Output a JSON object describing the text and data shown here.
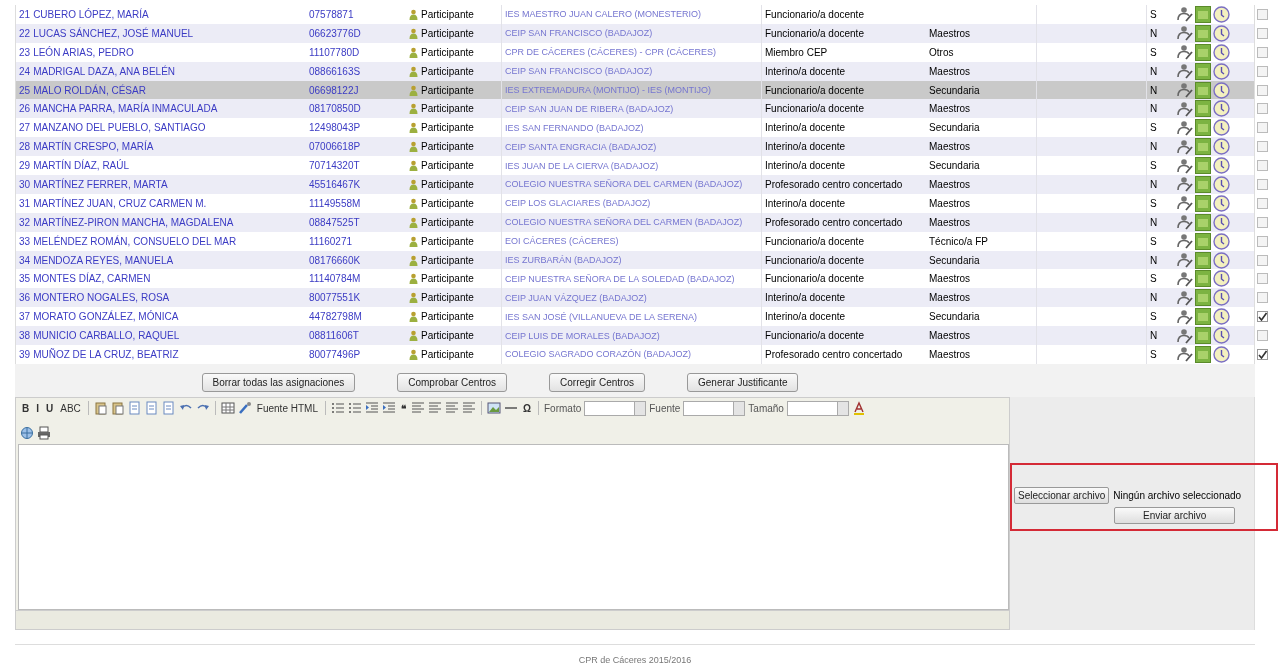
{
  "rows": [
    {
      "number": "21",
      "name": "CUBERO LÓPEZ, MARÍA",
      "code": "07578871",
      "role": "Participante",
      "center": "IES MAESTRO JUAN CALERO (MONESTERIO)",
      "type": "Funcionario/a docente",
      "level": "",
      "flag": "S",
      "selected": false,
      "checked": false
    },
    {
      "number": "22",
      "name": "LUCAS SÁNCHEZ, JOSÉ MANUEL",
      "code": "06623776D",
      "role": "Participante",
      "center": "CEIP SAN FRANCISCO (BADAJOZ)",
      "type": "Funcionario/a docente",
      "level": "Maestros",
      "flag": "N",
      "selected": false,
      "checked": false
    },
    {
      "number": "23",
      "name": "LEÓN ARIAS, PEDRO",
      "code": "11107780D",
      "role": "Participante",
      "center": "CPR DE CÁCERES (CÁCERES) - CPR (CÁCERES)",
      "type": "Miembro CEP",
      "level": "Otros",
      "flag": "S",
      "selected": false,
      "checked": false
    },
    {
      "number": "24",
      "name": "MADRIGAL DAZA, ANA BELÉN",
      "code": "08866163S",
      "role": "Participante",
      "center": "CEIP SAN FRANCISCO (BADAJOZ)",
      "type": "Interino/a docente",
      "level": "Maestros",
      "flag": "N",
      "selected": false,
      "checked": false
    },
    {
      "number": "25",
      "name": "MALO ROLDÁN, CÉSAR",
      "code": "06698122J",
      "role": "Participante",
      "center": "IES EXTREMADURA (MONTIJO) - IES (MONTIJO)",
      "type": "Funcionario/a docente",
      "level": "Secundaria",
      "flag": "N",
      "selected": true,
      "checked": false
    },
    {
      "number": "26",
      "name": "MANCHA PARRA, MARÍA INMACULADA",
      "code": "08170850D",
      "role": "Participante",
      "center": "CEIP SAN JUAN DE RIBERA (BADAJOZ)",
      "type": "Funcionario/a docente",
      "level": "Maestros",
      "flag": "N",
      "selected": false,
      "checked": false
    },
    {
      "number": "27",
      "name": "MANZANO DEL PUEBLO, SANTIAGO",
      "code": "12498043P",
      "role": "Participante",
      "center": "IES SAN FERNANDO (BADAJOZ)",
      "type": "Interino/a docente",
      "level": "Secundaria",
      "flag": "S",
      "selected": false,
      "checked": false
    },
    {
      "number": "28",
      "name": "MARTÍN CRESPO, MARÍA",
      "code": "07006618P",
      "role": "Participante",
      "center": "CEIP SANTA ENGRACIA (BADAJOZ)",
      "type": "Interino/a docente",
      "level": "Maestros",
      "flag": "N",
      "selected": false,
      "checked": false
    },
    {
      "number": "29",
      "name": "MARTÍN DÍAZ, RAÚL",
      "code": "70714320T",
      "role": "Participante",
      "center": "IES JUAN DE LA CIERVA (BADAJOZ)",
      "type": "Interino/a docente",
      "level": "Secundaria",
      "flag": "S",
      "selected": false,
      "checked": false
    },
    {
      "number": "30",
      "name": "MARTÍNEZ FERRER, MARTA",
      "code": "45516467K",
      "role": "Participante",
      "center": "COLEGIO NUESTRA SEÑORA DEL CARMEN (BADAJOZ)",
      "type": "Profesorado centro concertado",
      "level": "Maestros",
      "flag": "N",
      "selected": false,
      "checked": false
    },
    {
      "number": "31",
      "name": "MARTÍNEZ JUAN, CRUZ CARMEN M.",
      "code": "11149558M",
      "role": "Participante",
      "center": "CEIP LOS GLACIARES (BADAJOZ)",
      "type": "Interino/a docente",
      "level": "Maestros",
      "flag": "S",
      "selected": false,
      "checked": false
    },
    {
      "number": "32",
      "name": "MARTÍNEZ-PIRON MANCHA, MAGDALENA",
      "code": "08847525T",
      "role": "Participante",
      "center": "COLEGIO NUESTRA SEÑORA DEL CARMEN (BADAJOZ)",
      "type": "Profesorado centro concertado",
      "level": "Maestros",
      "flag": "N",
      "selected": false,
      "checked": false
    },
    {
      "number": "33",
      "name": "MELÉNDEZ ROMÁN, CONSUELO DEL MAR",
      "code": "11160271",
      "role": "Participante",
      "center": "EOI CÁCERES (CÁCERES)",
      "type": "Funcionario/a docente",
      "level": "Técnico/a FP",
      "flag": "S",
      "selected": false,
      "checked": false
    },
    {
      "number": "34",
      "name": "MENDOZA REYES, MANUELA",
      "code": "08176660K",
      "role": "Participante",
      "center": "IES ZURBARÁN (BADAJOZ)",
      "type": "Funcionario/a docente",
      "level": "Secundaria",
      "flag": "N",
      "selected": false,
      "checked": false
    },
    {
      "number": "35",
      "name": "MONTES DÍAZ, CARMEN",
      "code": "11140784M",
      "role": "Participante",
      "center": "CEIP NUESTRA SEÑORA DE LA SOLEDAD (BADAJOZ)",
      "type": "Funcionario/a docente",
      "level": "Maestros",
      "flag": "S",
      "selected": false,
      "checked": false
    },
    {
      "number": "36",
      "name": "MONTERO NOGALES, ROSA",
      "code": "80077551K",
      "role": "Participante",
      "center": "CEIP JUAN VÁZQUEZ (BADAJOZ)",
      "type": "Interino/a docente",
      "level": "Maestros",
      "flag": "N",
      "selected": false,
      "checked": false
    },
    {
      "number": "37",
      "name": "MORATO GONZÁLEZ, MÓNICA",
      "code": "44782798M",
      "role": "Participante",
      "center": "IES SAN JOSÉ (VILLANUEVA DE LA SERENA)",
      "type": "Interino/a docente",
      "level": "Secundaria",
      "flag": "S",
      "selected": false,
      "checked": true
    },
    {
      "number": "38",
      "name": "MUNICIO CARBALLO, RAQUEL",
      "code": "08811606T",
      "role": "Participante",
      "center": "CEIP LUIS DE MORALES (BADAJOZ)",
      "type": "Funcionario/a docente",
      "level": "Maestros",
      "flag": "N",
      "selected": false,
      "checked": false
    },
    {
      "number": "39",
      "name": "MUÑOZ DE LA CRUZ, BEATRIZ",
      "code": "80077496P",
      "role": "Participante",
      "center": "COLEGIO SAGRADO CORAZÓN (BADAJOZ)",
      "type": "Profesorado centro concertado",
      "level": "Maestros",
      "flag": "S",
      "selected": false,
      "checked": true
    }
  ],
  "actions": [
    "Borrar todas las asignaciones",
    "Comprobar Centros",
    "Corregir Centros",
    "Generar Justificante"
  ],
  "editor": {
    "toolbar": [
      {
        "kind": "glyph",
        "text": "B"
      },
      {
        "kind": "glyph",
        "text": "I"
      },
      {
        "kind": "glyph",
        "text": "U"
      },
      {
        "kind": "glyph",
        "text": "ABC"
      },
      {
        "kind": "sep"
      },
      {
        "kind": "icon"
      },
      {
        "kind": "icon"
      },
      {
        "kind": "icon"
      },
      {
        "kind": "icon"
      },
      {
        "kind": "icon"
      },
      {
        "kind": "icon"
      },
      {
        "kind": "icon"
      },
      {
        "kind": "sep"
      },
      {
        "kind": "icon"
      },
      {
        "kind": "icon"
      },
      {
        "kind": "glyph",
        "text": "Fuente HTML"
      },
      {
        "kind": "sep"
      },
      {
        "kind": "icon"
      },
      {
        "kind": "icon"
      },
      {
        "kind": "icon"
      },
      {
        "kind": "icon"
      },
      {
        "kind": "glyph",
        "text": "❝"
      },
      {
        "kind": "icon"
      },
      {
        "kind": "icon"
      },
      {
        "kind": "icon"
      },
      {
        "kind": "icon"
      },
      {
        "kind": "sep"
      },
      {
        "kind": "icon"
      },
      {
        "kind": "icon"
      },
      {
        "kind": "glyph",
        "text": "Ω"
      },
      {
        "kind": "sep"
      },
      {
        "kind": "select",
        "text": "Formato"
      },
      {
        "kind": "select",
        "text": "Fuente"
      },
      {
        "kind": "select",
        "text": "Tamaño"
      },
      {
        "kind": "icon"
      },
      {
        "kind": "break"
      },
      {
        "kind": "icon"
      },
      {
        "kind": "icon"
      }
    ]
  },
  "upload": {
    "highlighted": true,
    "choose_button": "Seleccionar archivo",
    "file_status": "Ningún archivo seleccionado",
    "send_button": "Enviar archivo"
  },
  "footer": "CPR de Cáceres 2015/2016"
}
